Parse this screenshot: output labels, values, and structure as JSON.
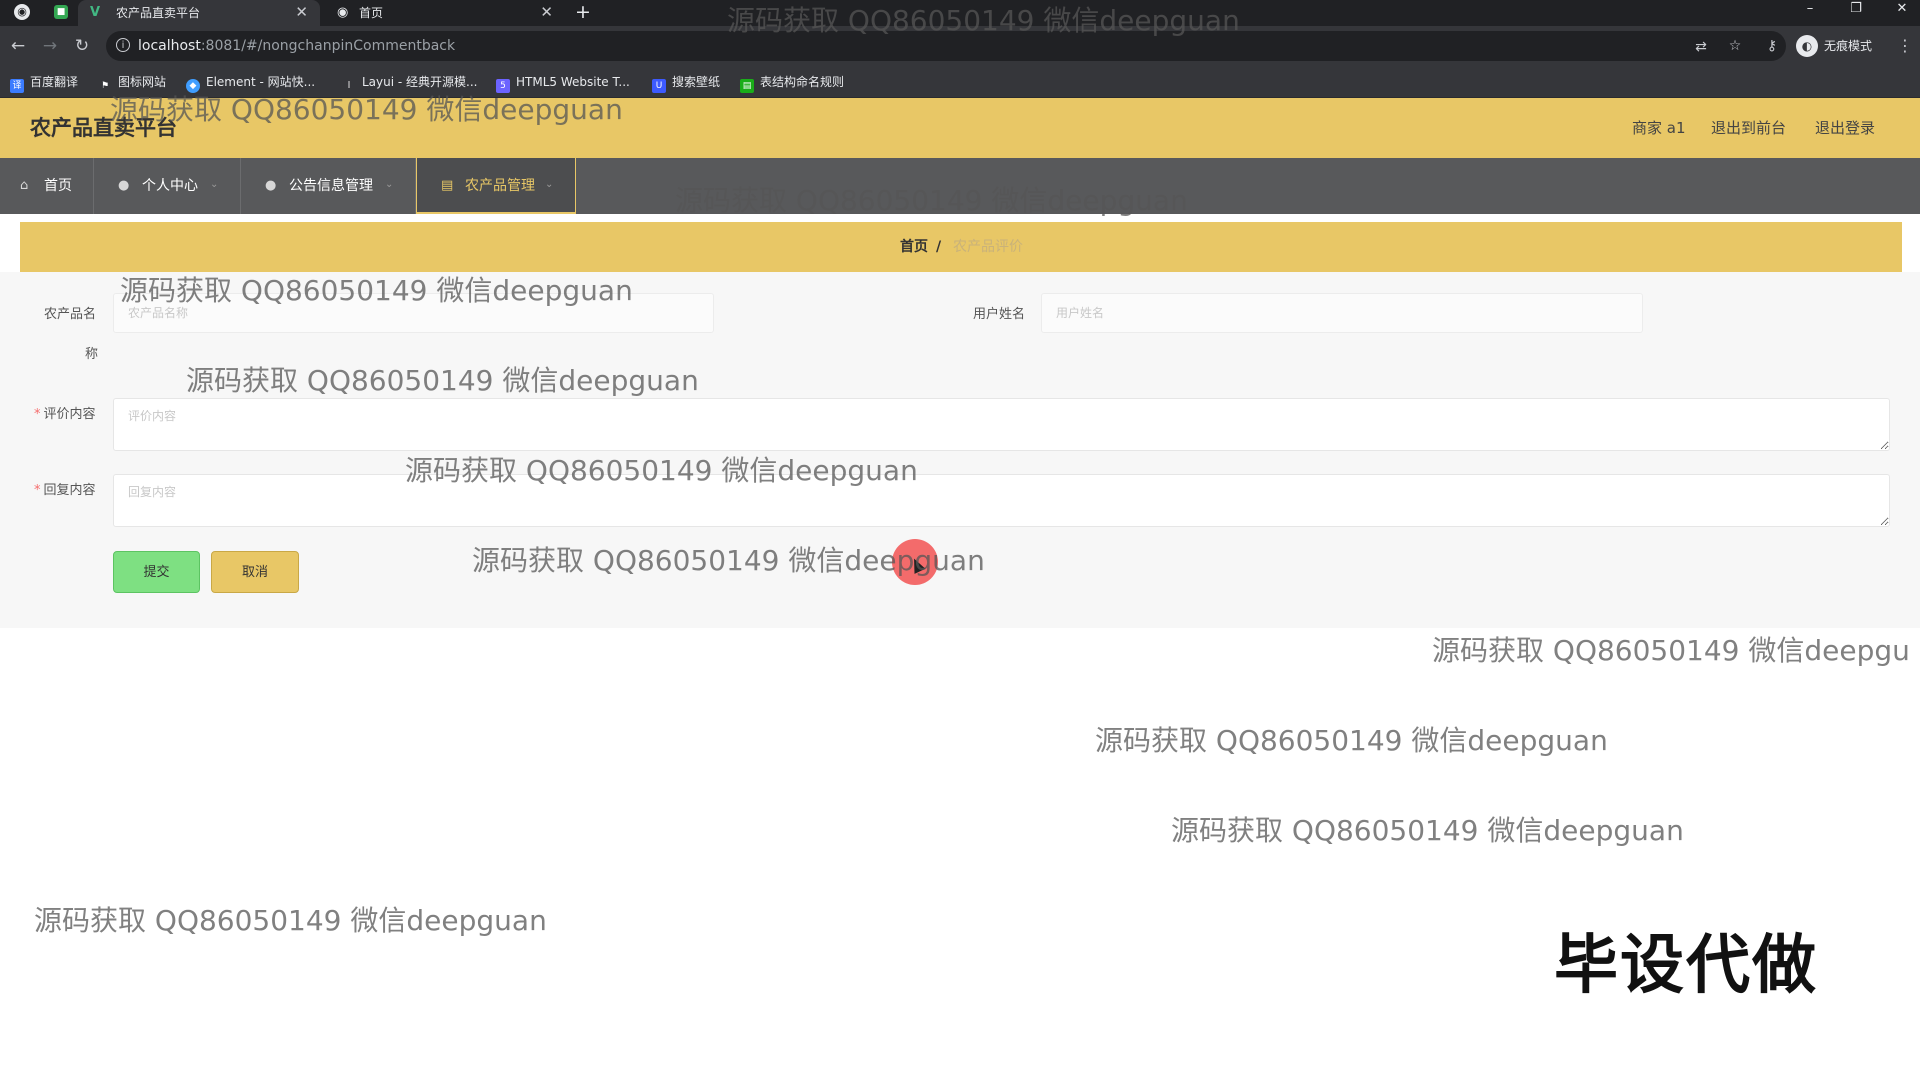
{
  "browser": {
    "tabs": [
      {
        "label": "农产品直卖平台",
        "favicon": "V"
      },
      {
        "label": "首页",
        "favicon": "globe-icon"
      }
    ],
    "new_tab": "+",
    "url_host": "localhost",
    "url_rest": ":8081/#/nongchanpinCommentback",
    "incognito_label": "无痕模式",
    "bookmarks": [
      {
        "label": "百度翻译",
        "color": "#3b7cff"
      },
      {
        "label": "图标网站",
        "color": "#35363a"
      },
      {
        "label": "Element - 网站快...",
        "color": "#409eff"
      },
      {
        "label": "Layui - 经典开源模...",
        "color": "#35363a"
      },
      {
        "label": "HTML5 Website T...",
        "color": "#6c63ff"
      },
      {
        "label": "搜索壁纸",
        "color": "#3d5afe"
      },
      {
        "label": "表结构命名规则",
        "color": "#1aad19"
      }
    ]
  },
  "header": {
    "title": "农产品直卖平台",
    "user": "商家 a1",
    "back_to_front": "退出到前台",
    "logout": "退出登录"
  },
  "nav": [
    {
      "label": "首页",
      "icon": "home-icon",
      "has_caret": false,
      "active": false
    },
    {
      "label": "个人中心",
      "icon": "user-icon",
      "has_caret": true,
      "active": false
    },
    {
      "label": "公告信息管理",
      "icon": "user-icon",
      "has_caret": true,
      "active": false
    },
    {
      "label": "农产品管理",
      "icon": "document-icon",
      "has_caret": true,
      "active": true
    }
  ],
  "breadcrumb": {
    "home": "首页",
    "separator": "/",
    "current": "农产品评价"
  },
  "form": {
    "product_name_label": "农产品名",
    "product_name_label_wrap": "称",
    "product_name_placeholder": "农产品名称",
    "username_label": "用户姓名",
    "username_placeholder": "用户姓名",
    "comment_label": "评价内容",
    "comment_placeholder": "评价内容",
    "reply_label": "回复内容",
    "reply_placeholder": "回复内容",
    "required_mark": "*",
    "submit_label": "提交",
    "cancel_label": "取消"
  },
  "watermarks": [
    "源码获取 QQ86050149 微信deepguan",
    "源码获取 QQ86050149 微信deepguan",
    "源码获取 QQ86050149 微信deepguan",
    "源码获取 QQ86050149 微信deepguan",
    "源码获取 QQ86050149 微信deepguan",
    "源码获取 QQ86050149 微信deepguan",
    "源码获取 QQ86050149 微信deepguan",
    "源码获取 QQ86050149 微信deepgu",
    "源码获取 QQ86050149 微信deepguan",
    "源码获取 QQ86050149 微信deepguan",
    "源码获取 QQ86050149 微信deepguan"
  ],
  "stamp": "毕设代做",
  "colors": {
    "header_bg": "#e8c766",
    "nav_bg": "#58595b",
    "submit_bg": "#7ee082",
    "cancel_bg": "#e8c766",
    "required": "#f56c6c"
  }
}
